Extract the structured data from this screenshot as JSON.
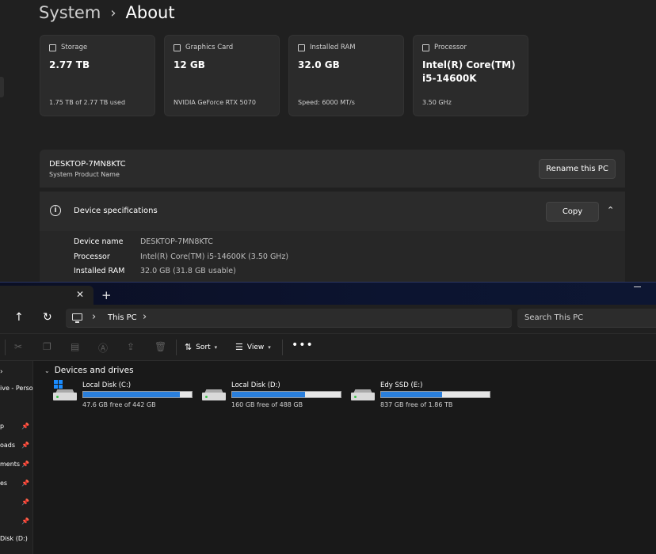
{
  "settings": {
    "breadcrumb": {
      "parent": "System",
      "separator": "›",
      "current": "About"
    },
    "cards": [
      {
        "title": "Storage",
        "icon": "storage-icon",
        "value": "2.77 TB",
        "detail": "1.75 TB of 2.77 TB used"
      },
      {
        "title": "Graphics Card",
        "icon": "graphics-card-icon",
        "value": "12 GB",
        "detail": "NVIDIA GeForce RTX 5070"
      },
      {
        "title": "Installed RAM",
        "icon": "ram-icon",
        "value": "32.0 GB",
        "detail": "Speed: 6000 MT/s"
      },
      {
        "title": "Processor",
        "icon": "processor-icon",
        "value": "Intel(R) Core(TM) i5-14600K",
        "detail": "3.50 GHz"
      }
    ],
    "pc": {
      "name": "DESKTOP-7MN8KTC",
      "label": "System Product Name",
      "rename_label": "Rename this PC"
    },
    "device_specs": {
      "title": "Device specifications",
      "copy_label": "Copy",
      "rows": [
        {
          "key": "Device name",
          "value": "DESKTOP-7MN8KTC"
        },
        {
          "key": "Processor",
          "value": "Intel(R) Core(TM) i5-14600K (3.50 GHz)"
        },
        {
          "key": "Installed RAM",
          "value": "32.0 GB (31.8 GB usable)"
        }
      ]
    }
  },
  "explorer": {
    "tab": {
      "close_glyph": "✕",
      "new_glyph": "+"
    },
    "address": {
      "location": "This PC",
      "chevron": "›"
    },
    "search": {
      "placeholder": "Search This PC"
    },
    "toolbar": {
      "sort_label": "Sort",
      "view_label": "View",
      "more_glyph": "•••"
    },
    "sidebar": [
      {
        "label": "ive - Perso",
        "pinned": false
      },
      {
        "label": "p",
        "pinned": true
      },
      {
        "label": "oads",
        "pinned": true
      },
      {
        "label": "ments",
        "pinned": true
      },
      {
        "label": "es",
        "pinned": true
      },
      {
        "label": "",
        "pinned": true
      },
      {
        "label": "",
        "pinned": true
      },
      {
        "label": "Disk (D:)",
        "pinned": false
      }
    ],
    "group": {
      "title": "Devices and drives"
    },
    "drives": [
      {
        "name": "Local Disk (C:)",
        "free_text": "47.6 GB free of 442 GB",
        "used_fraction": 0.89,
        "system": true
      },
      {
        "name": "Local Disk (D:)",
        "free_text": "160 GB free of 488 GB",
        "used_fraction": 0.67,
        "system": false
      },
      {
        "name": "Edy SSD (E:)",
        "free_text": "837 GB free of 1.86 TB",
        "used_fraction": 0.56,
        "system": false
      }
    ]
  },
  "colors": {
    "accent": "#2a7fdc",
    "background": "#202020",
    "card": "#2b2b2b"
  }
}
